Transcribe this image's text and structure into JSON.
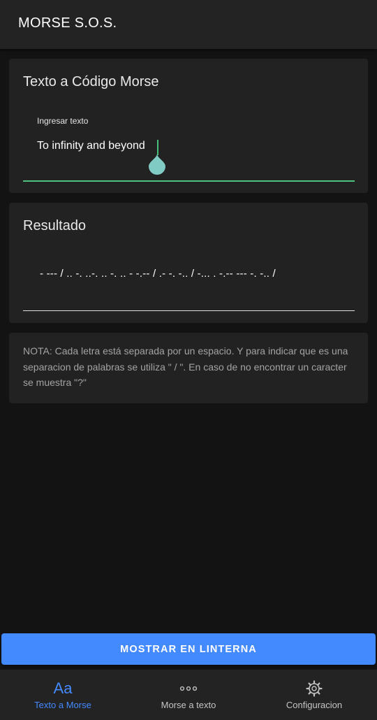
{
  "app": {
    "title": "MORSE S.O.S."
  },
  "input_card": {
    "title": "Texto a Código Morse",
    "field_label": "Ingresar texto",
    "field_value": "To infinity and beyond"
  },
  "result_card": {
    "title": "Resultado",
    "morse": "- --- / .. -. ..-. .. -. .. - -.-- / .- -. -.. / -... . -.-- --- -. -.. /"
  },
  "note": {
    "text": "NOTA: Cada letra está separada por un espacio. Y para indicar que es una separacion de palabras se utiliza \" / \". En caso de no encontrar un caracter se muestra \"?\""
  },
  "action": {
    "label": "MOSTRAR EN LINTERNA"
  },
  "bottom_nav": {
    "items": [
      {
        "label": "Texto a Morse",
        "icon": "text-aa-icon",
        "glyph": "Aa",
        "active": true
      },
      {
        "label": "Morse a texto",
        "icon": "dots-icon",
        "active": false
      },
      {
        "label": "Configuracion",
        "icon": "gear-icon",
        "active": false
      }
    ]
  },
  "colors": {
    "accent": "#448aff",
    "focus_underline": "#4ec27f",
    "cursor_handle": "#80cbc4"
  }
}
